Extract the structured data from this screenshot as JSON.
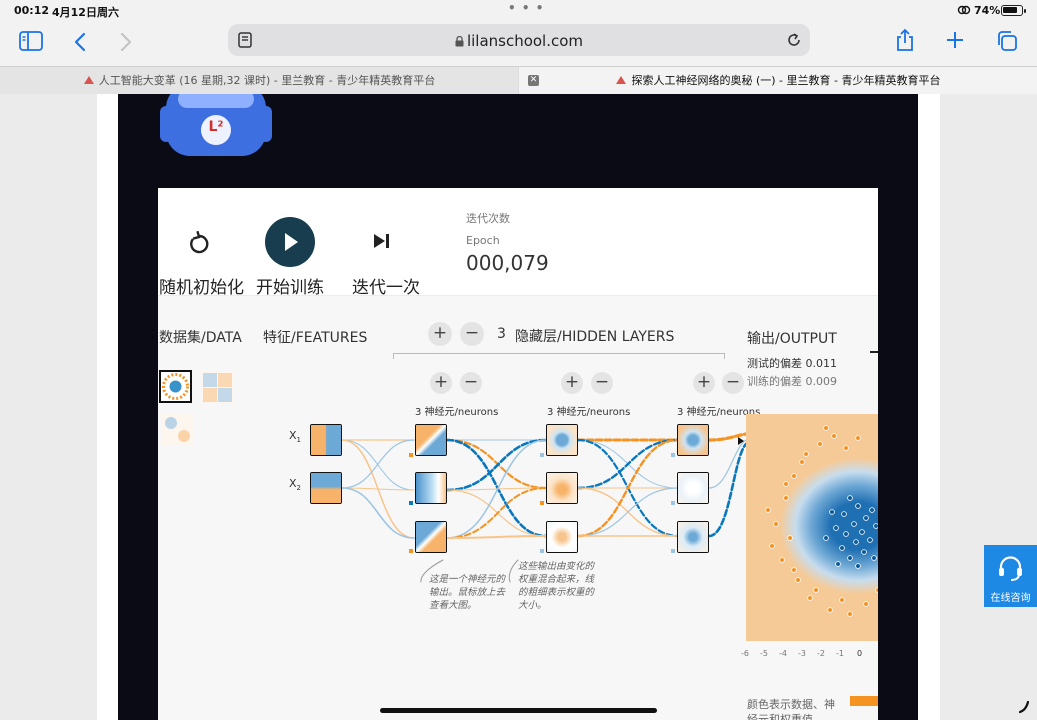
{
  "status_bar": {
    "time": "00:12",
    "date": "4月12日周六",
    "battery": "74%"
  },
  "browser": {
    "url": "lilanschool.com"
  },
  "tabs": [
    {
      "title": "人工智能大变革 (16 星期,32 课时) - 里兰教育 - 青少年精英教育平台"
    },
    {
      "title": "探索人工神经网络的奥秘 (一) - 里兰教育 - 青少年精英教育平台"
    }
  ],
  "logo": {
    "text": "L²"
  },
  "controls": {
    "reset_label": "随机初始化",
    "play_label": "开始训练",
    "step_label": "迭代一次",
    "epoch_cn": "迭代次数",
    "epoch_en": "Epoch",
    "epoch_value": "000,079"
  },
  "sections": {
    "data": "数据集/DATA",
    "features": "特征/FEATURES",
    "layers_count": "3",
    "hidden_layers": "隐藏层/HIDDEN LAYERS",
    "output": "输出/OUTPUT"
  },
  "output": {
    "test_loss": "测试的偏差 0.011",
    "train_loss": "训练的偏差 0.009"
  },
  "features": [
    {
      "label": "X",
      "sub": "1"
    },
    {
      "label": "X",
      "sub": "2"
    }
  ],
  "layers": [
    {
      "neurons_label": "3 神经元/neurons"
    },
    {
      "neurons_label": "3 神经元/neurons"
    },
    {
      "neurons_label": "3 神经元/neurons"
    }
  ],
  "annotations": {
    "a1": [
      "这是一个神经元的",
      "输出。鼠标放上去",
      "查看大图。"
    ],
    "a2": [
      "这些输出由变化的",
      "权重混合起来，线",
      "的粗细表示权重的",
      "大小。"
    ]
  },
  "axis_ticks": [
    "-6",
    "-5",
    "-4",
    "-3",
    "-2",
    "-1",
    "0"
  ],
  "legend": {
    "line1": "颜色表示数据、神",
    "line2": "经元和权重值"
  },
  "chat_widget": {
    "label": "在线咨询"
  },
  "colors": {
    "orange": "#f59322",
    "blue": "#0877bd",
    "play_bg": "#183d4e",
    "accent_ios": "#1a73e8"
  }
}
